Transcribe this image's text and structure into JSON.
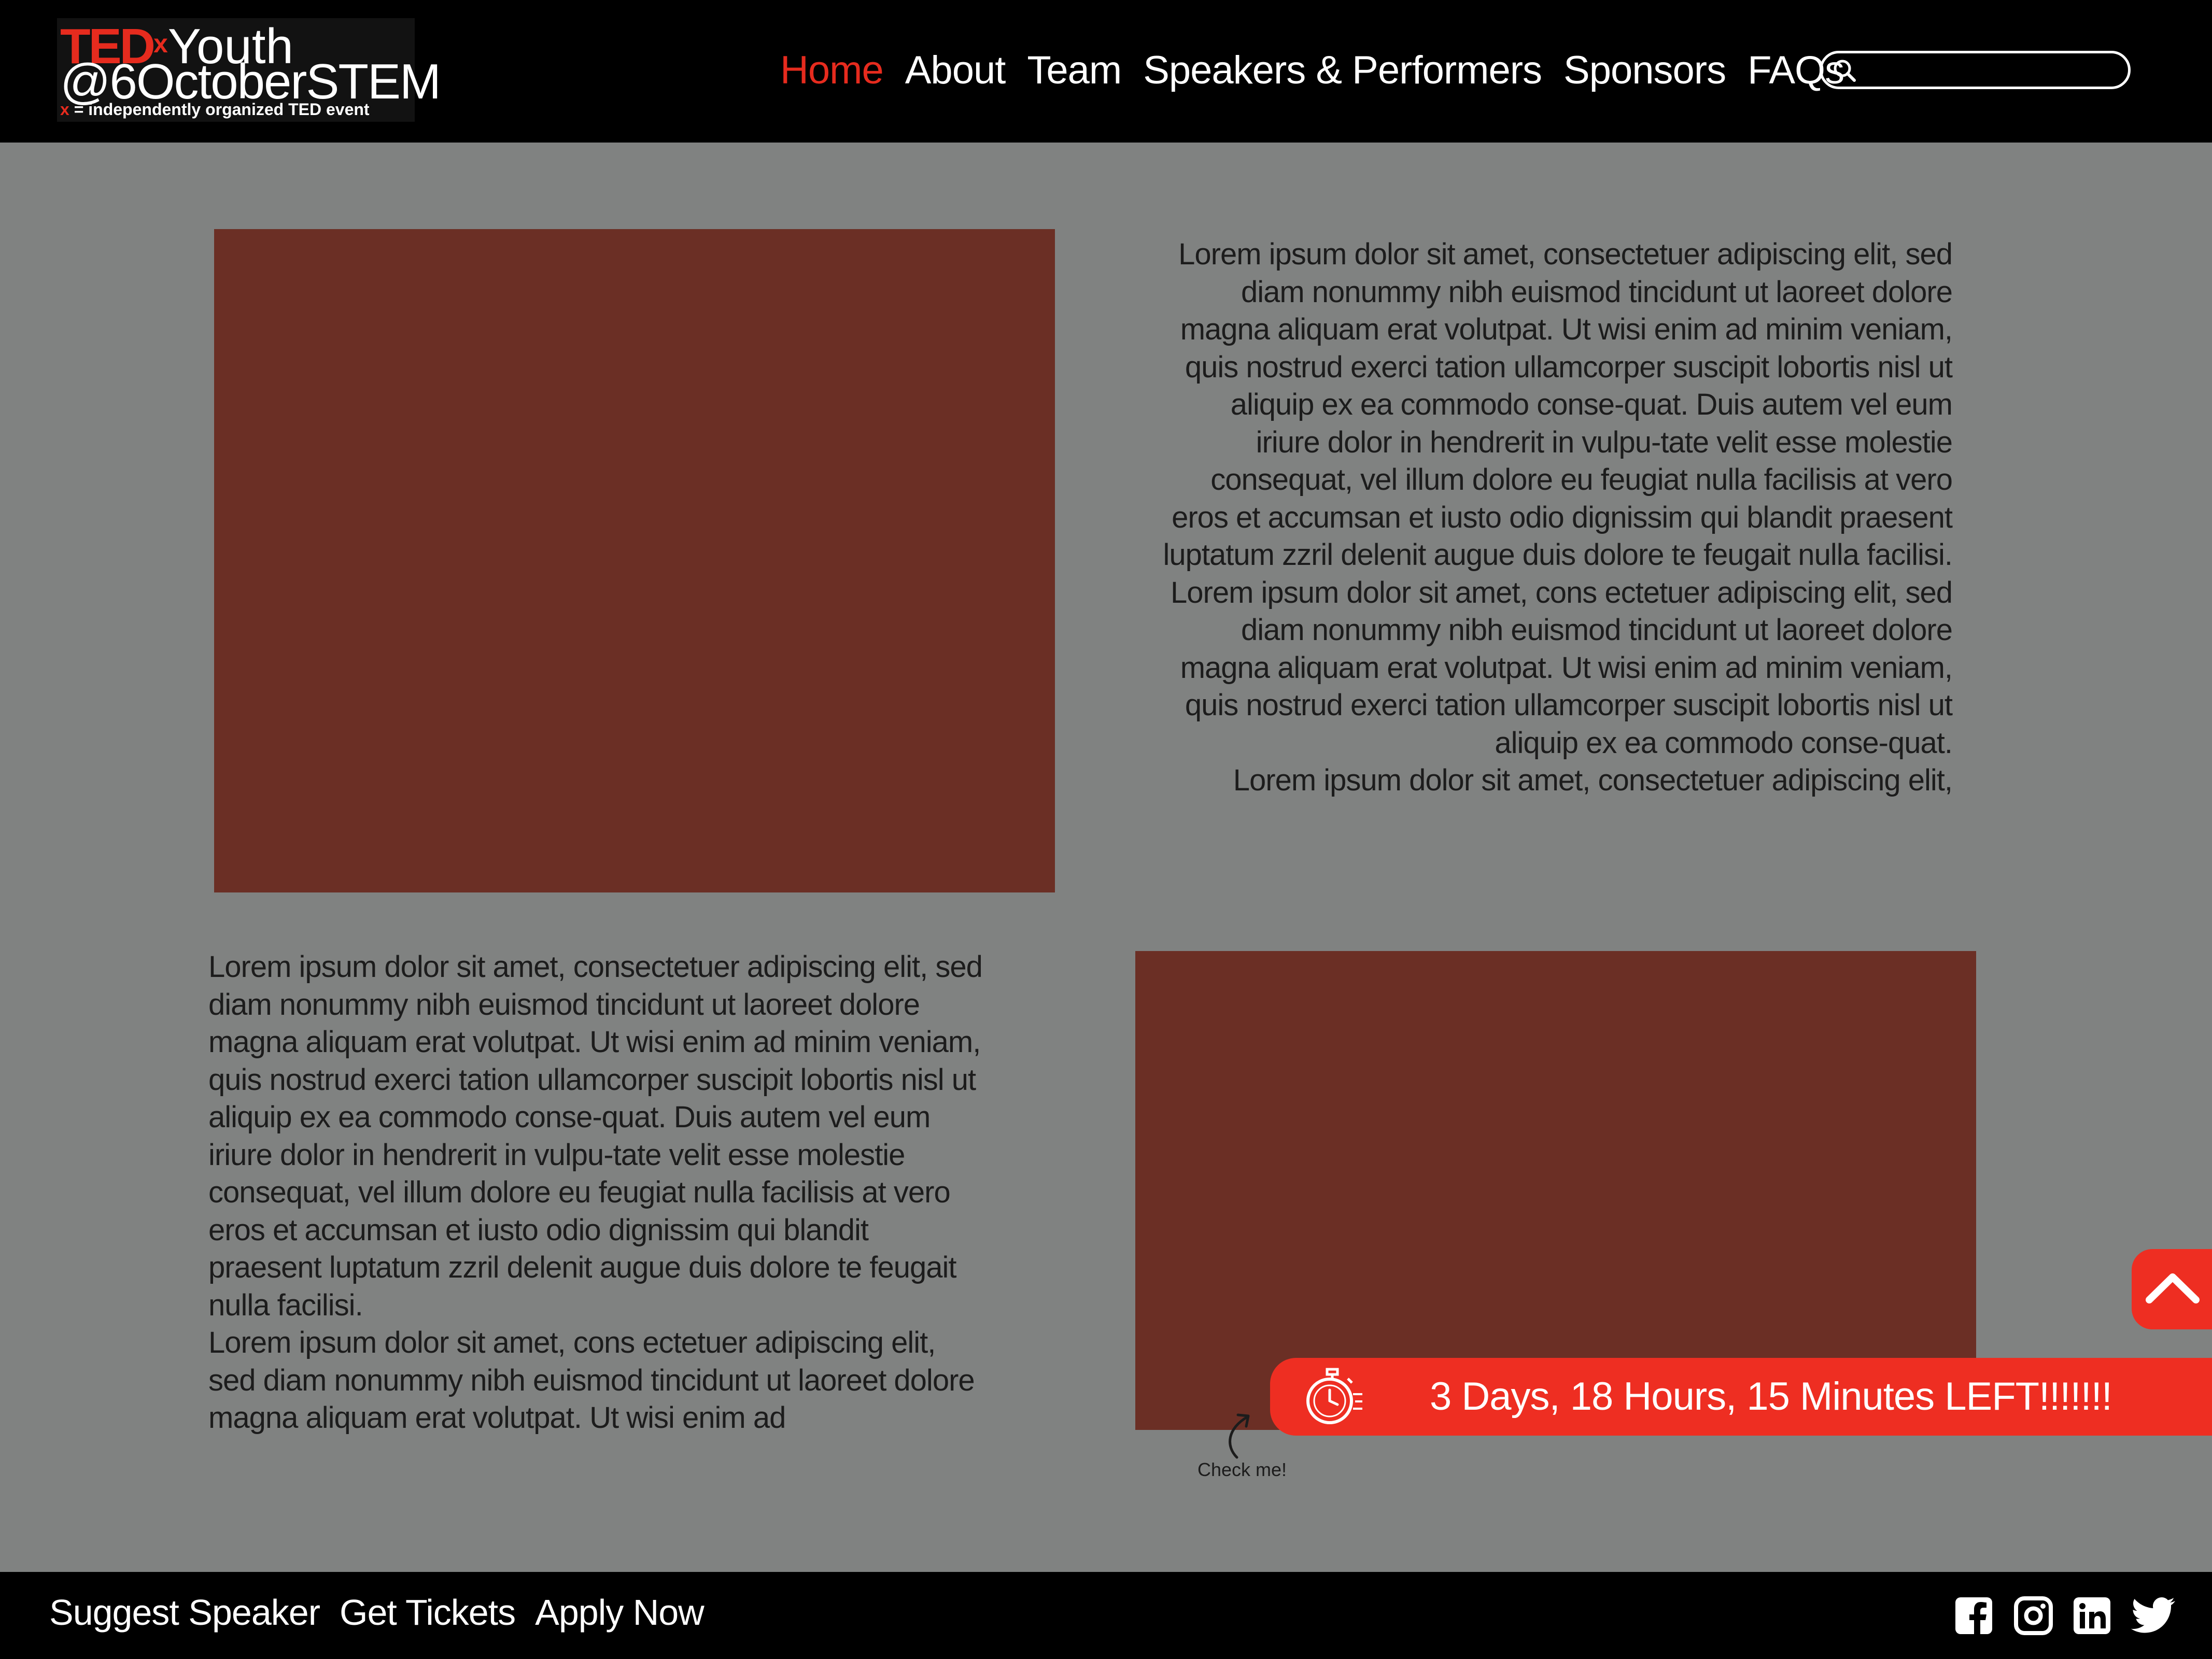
{
  "header": {
    "logo": {
      "brand": "TED",
      "brand_x": "x",
      "event": "Youth",
      "chapter": "@6OctoberSTEM",
      "tagline_x": "x",
      "tagline": " = independently organized TED event"
    },
    "nav": [
      {
        "label": "Home",
        "active": true
      },
      {
        "label": "About"
      },
      {
        "label": "Team"
      },
      {
        "label": "Speakers & Performers"
      },
      {
        "label": "Sponsors"
      },
      {
        "label": "FAQs"
      }
    ],
    "search": {
      "icon": "search-icon",
      "value": "",
      "placeholder": ""
    }
  },
  "main": {
    "right_text": [
      "Lorem ipsum dolor sit amet, consectetuer adipiscing elit, sed diam nonummy nibh euismod tincidunt ut laoreet dolore magna aliquam erat volutpat. Ut wisi enim ad minim veniam, quis nostrud exerci tation ullamcorper suscipit lobortis nisl ut aliquip ex ea commodo conse-quat. Duis autem vel eum iriure dolor in hendrerit in vulpu-tate velit esse molestie consequat, vel illum dolore eu feugiat nulla facilisis at vero eros et accumsan et iusto odio dignissim qui blandit praesent luptatum zzril delenit augue duis dolore te feugait nulla facilisi.",
      "Lorem ipsum dolor sit amet, cons ectetuer adipiscing elit, sed diam nonummy nibh euismod tincidunt ut laoreet dolore magna aliquam erat volutpat. Ut wisi enim ad minim veniam, quis nostrud exerci tation ullamcorper suscipit lobortis nisl ut aliquip ex ea commodo conse-quat.",
      "Lorem ipsum dolor sit amet, consectetuer adipiscing elit,"
    ],
    "left_text": [
      "Lorem ipsum dolor sit amet, consectetuer adipiscing elit, sed diam nonummy nibh euismod tincidunt ut laoreet dolore magna aliquam erat volutpat. Ut wisi enim ad minim veniam, quis nostrud exerci tation ullamcorper suscipit lobortis nisl ut aliquip ex ea commodo conse-quat. Duis autem vel eum iriure dolor in hendrerit in vulpu-tate velit esse molestie consequat, vel illum dolore eu feugiat nulla facilisis at vero eros et accumsan et iusto odio dignissim qui blandit praesent luptatum zzril delenit augue duis dolore te feugait nulla facilisi.",
      "Lorem ipsum dolor sit amet, cons ectetuer adipiscing elit, sed diam nonummy nibh euismod tincidunt ut laoreet dolore magna aliquam erat volutpat. Ut wisi enim ad"
    ],
    "image_placeholder_color": "#6b2f25",
    "check_label": "Check me!"
  },
  "countdown": {
    "icon": "stopwatch-icon",
    "text": "3 Days, 18 Hours, 15 Minutes LEFT!!!!!!!"
  },
  "scroll_top": {
    "icon": "chevron-up-icon"
  },
  "footer": {
    "links": [
      "Suggest Speaker",
      "Get Tickets",
      "Apply Now"
    ],
    "social": [
      "facebook-icon",
      "instagram-icon",
      "linkedin-icon",
      "twitter-icon"
    ]
  },
  "colors": {
    "accent": "#e62b1e",
    "banner": "#ee2e22",
    "background": "#808281",
    "bar": "#000000"
  }
}
